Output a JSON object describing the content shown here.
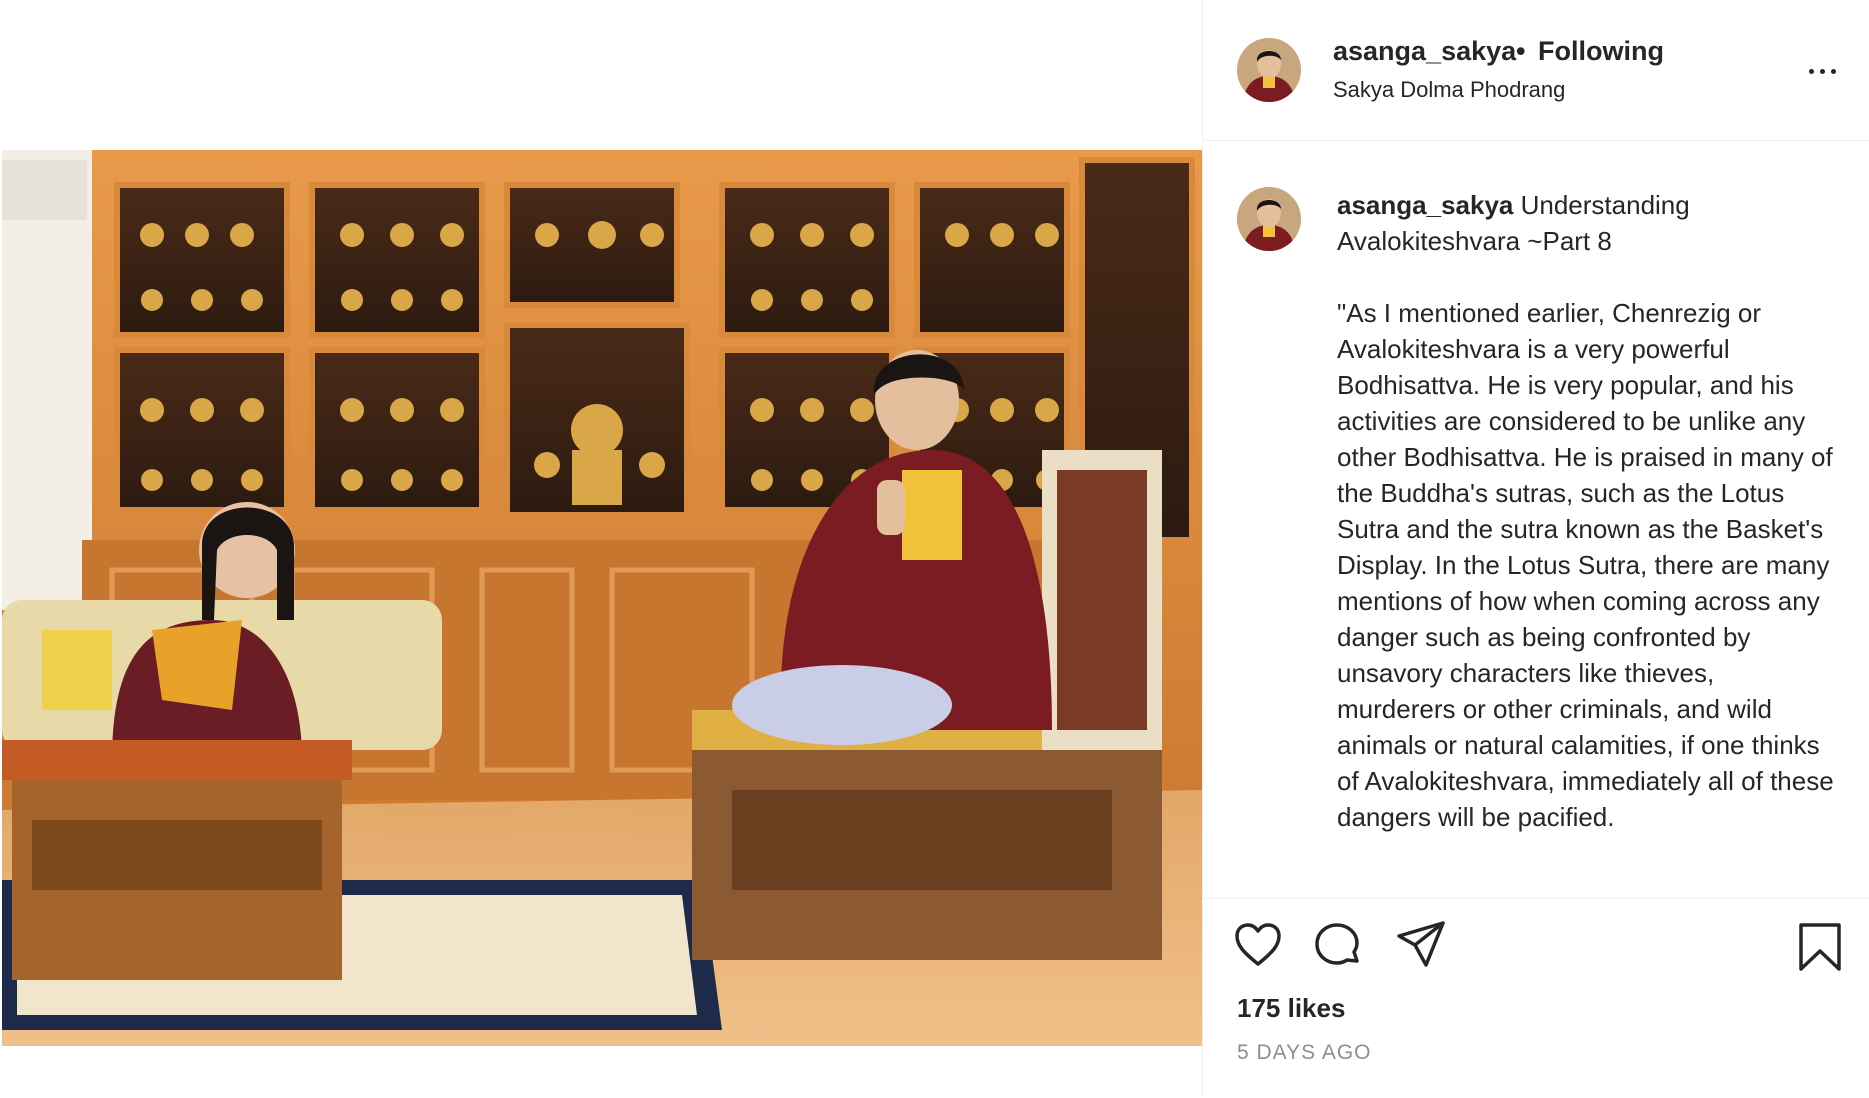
{
  "post": {
    "username": "asanga_sakya",
    "separator": "•",
    "follow_status": "Following",
    "location": "Sakya Dolma Phodrang",
    "more_icon": "more-options-icon"
  },
  "caption": {
    "username": "asanga_sakya",
    "title": "Understanding Avalokiteshvara ~Part 8",
    "body": "\"As I mentioned earlier, Chenrezig or Avalokiteshvara is a very powerful Bodhisattva. He is very popular, and his activities are considered to be unlike any other Bodhisattva. He is praised in many of the Buddha's sutras, such as the Lotus Sutra and the sutra known as the Basket's Display. In the Lotus Sutra, there are many mentions of how when coming across any danger such as being confronted by unsavory characters like thieves, murderers or other criminals, and wild animals or natural calamities, if one thinks of Avalokiteshvara, immediately all of these dangers will be pacified."
  },
  "actions": {
    "like_icon": "heart-icon",
    "comment_icon": "comment-icon",
    "share_icon": "share-icon",
    "save_icon": "bookmark-icon"
  },
  "stats": {
    "likes": "175 likes",
    "date": "5 DAYS AGO"
  },
  "colors": {
    "text": "#262626",
    "muted": "#8e8e8e",
    "border": "#efefef"
  }
}
